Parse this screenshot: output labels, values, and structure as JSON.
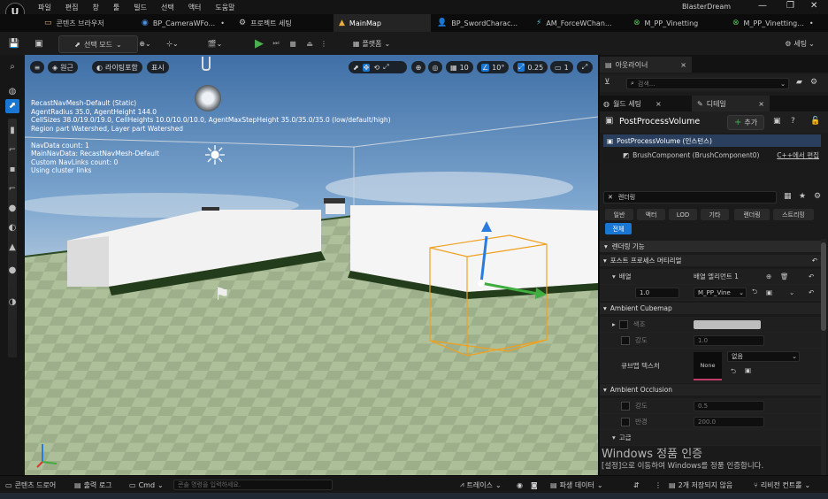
{
  "titlebar": {
    "menu": [
      "파일",
      "편집",
      "창",
      "툴",
      "빌드",
      "선택",
      "액터",
      "도움말"
    ],
    "project": "BlasterDream"
  },
  "tabs": [
    {
      "label": "콘텐츠 브라우저",
      "icon": "folder-icon"
    },
    {
      "label": "BP_CameraWFo...",
      "icon": "blueprint-icon",
      "dirty": "•"
    },
    {
      "label": "프로젝트 세팅",
      "icon": "gear-icon"
    },
    {
      "label": "MainMap",
      "icon": "map-icon",
      "active": true
    },
    {
      "label": "BP_SwordCharac...",
      "icon": "character-icon"
    },
    {
      "label": "AM_ForceWChan...",
      "icon": "anim-montage-icon"
    },
    {
      "label": "M_PP_Vinetting",
      "icon": "material-icon"
    },
    {
      "label": "M_PP_Vinetting...",
      "icon": "material-icon",
      "dirty": "•"
    }
  ],
  "toolbar": {
    "mode": "선택 모드",
    "platforms": "플랫폼",
    "settings": "세팅"
  },
  "viewport": {
    "perspective": "원근",
    "lighting": "라이팅포함",
    "show": "표시",
    "grid": "10",
    "rotation": "10°",
    "scale": "0.25",
    "camera_speed": "1",
    "stats": [
      "RecastNavMesh-Default (Static)",
      "AgentRadius 35.0, AgentHeight 144.0",
      "CellSizes 38.0/19.0/19.0, CellHeights 10.0/10.0/10.0, AgentMaxStepHeight 35.0/35.0/35.0 (low/default/high)",
      "Region part Watershed, Layer part Watershed",
      "",
      "NavData count: 1",
      "MainNavData: RecastNavMesh-Default",
      "Custom NavLinks count: 0",
      "Using cluster links"
    ]
  },
  "outliner": {
    "tab": "아웃라이너",
    "search_placeholder": "검색..."
  },
  "details": {
    "world_settings_tab": "월드 세팅",
    "details_tab": "디테일",
    "actor": "PostProcessVolume",
    "add": "추가",
    "instance": "PostProcessVolume (인스턴스)",
    "component": "BrushComponent (BrushComponent0)",
    "cpp_edit": "C++에서 편집",
    "filter_text": "렌더링",
    "filters": [
      "일반",
      "액터",
      "LOD",
      "기타",
      "렌더링",
      "스트리밍",
      "전체"
    ],
    "rendering_features": "렌더링 기능",
    "pp_materials": "포스트 프로세스 머티리얼",
    "array_label": "배열",
    "array_count": "배열 엘리먼트 1",
    "weight": "1.0",
    "material": "M_PP_Vine",
    "ambient_cubemap": "Ambient Cubemap",
    "tint": "색조",
    "intensity": "강도",
    "intensity_value": "1.0",
    "cubemap_texture": "큐브맵 텍스처",
    "none": "None",
    "none_dropdown": "없음",
    "ambient_occlusion": "Ambient Occlusion",
    "ao_intensity": "강도",
    "ao_intensity_value": "0.5",
    "ao_radius": "반경",
    "ao_radius_value": "200.0",
    "advanced": "고급"
  },
  "watermark": {
    "title": "Windows 정품 인증",
    "subtitle": "[설정]으로 이동하여 Windows를 정품 인증합니다."
  },
  "statusbar": {
    "content_drawer": "콘텐츠 드로어",
    "output_log": "출력 로그",
    "cmd": "Cmd",
    "console_placeholder": "콘솔 명령을 입력하세요.",
    "trace": "트레이스",
    "derived_data": "파생 데이터",
    "unsaved": "2개 저장되지 않음",
    "revision": "리비전 컨트롤"
  },
  "colors": {
    "accent_blue": "#1976d2",
    "play_green": "#4caf50",
    "selection_orange": "#f0a020"
  }
}
